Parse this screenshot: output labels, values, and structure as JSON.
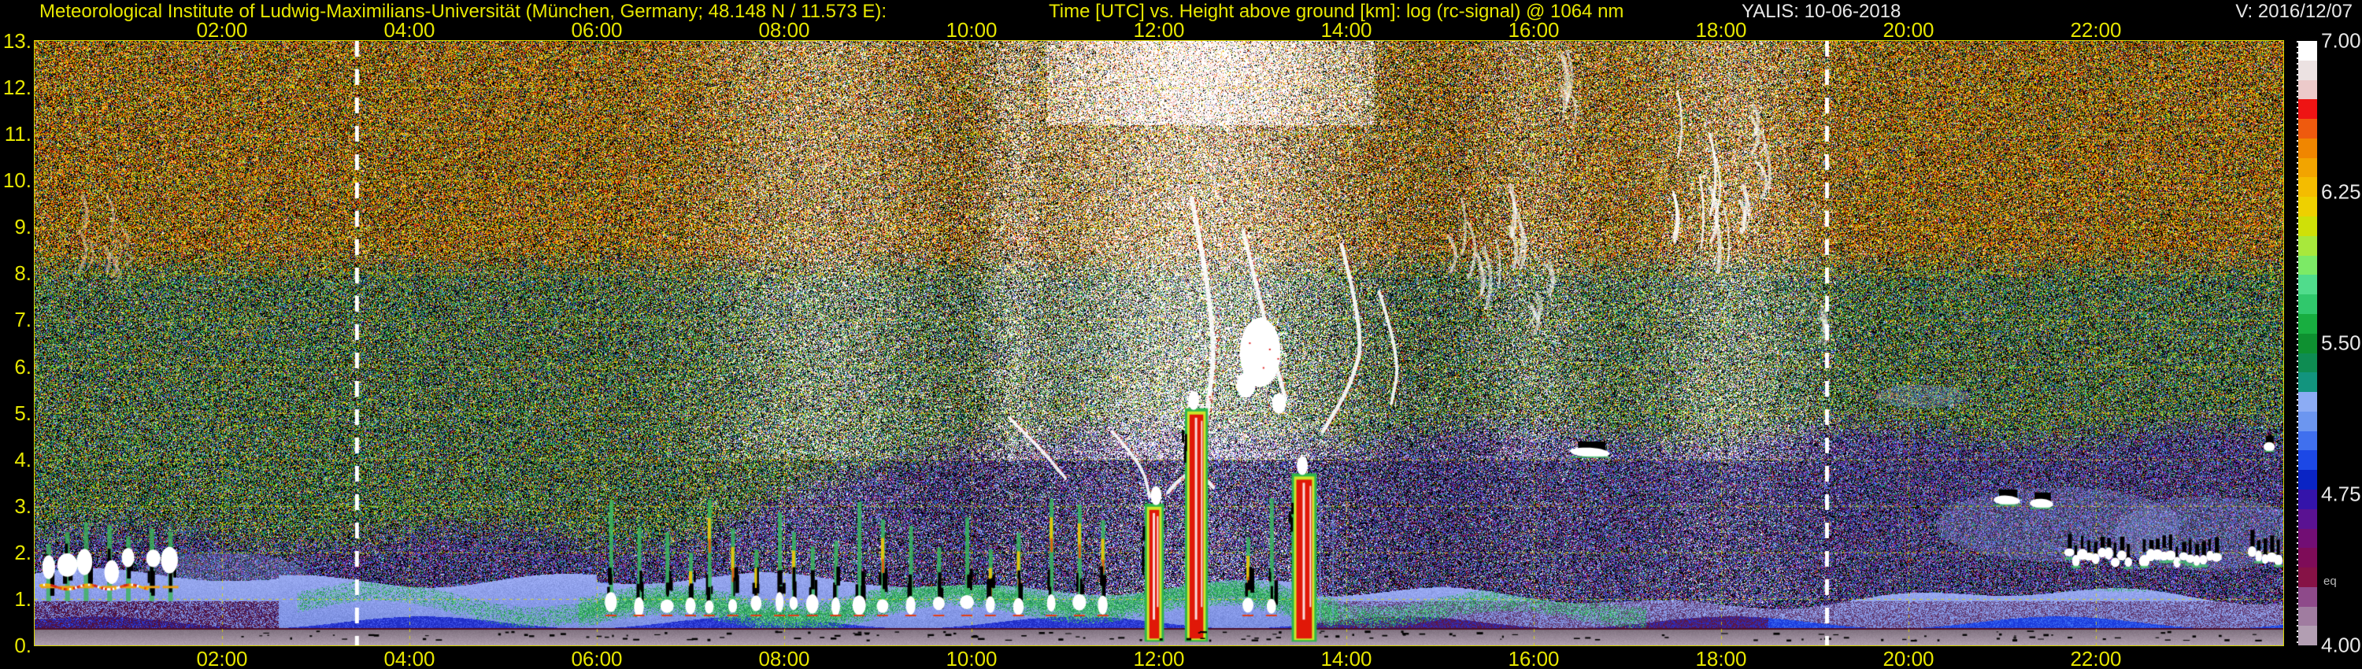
{
  "header": {
    "institute": "Meteorological Institute of Ludwig-Maximilians-Universität (München, Germany; 48.148 N / 11.573 E):",
    "plot_title": "Time [UTC] vs. Height above ground [km]: log (rc-signal) @ 1064 nm",
    "system_date": "YALIS: 10-06-2018",
    "version": "V: 2016/12/07"
  },
  "axes": {
    "x_ticks": {
      "hours": [
        2,
        4,
        6,
        8,
        10,
        12,
        14,
        16,
        18,
        20,
        22
      ],
      "labels": [
        "02:00",
        "04:00",
        "06:00",
        "08:00",
        "10:00",
        "12:00",
        "14:00",
        "16:00",
        "18:00",
        "20:00",
        "22:00"
      ]
    },
    "y_ticks": {
      "km": [
        13,
        12,
        11,
        10,
        9,
        8,
        7,
        6,
        5,
        4,
        3,
        2,
        1,
        0
      ],
      "labels": [
        "13.",
        "12.",
        "11.",
        "10.",
        "9.",
        "8.",
        "7.",
        "6.",
        "5.",
        "4.",
        "3.",
        "2.",
        "1.",
        "0."
      ]
    }
  },
  "colorbar": {
    "labels": [
      "7.00",
      "6.25",
      "5.50",
      "4.75",
      "4.00"
    ],
    "eq_label": "eq",
    "colors": [
      "#ffffff",
      "#ece2e2",
      "#eccaca",
      "#ee1414",
      "#ee5a0e",
      "#f08600",
      "#f2a400",
      "#f4bc00",
      "#eed000",
      "#cfe008",
      "#a8e83c",
      "#7cea66",
      "#50dc8c",
      "#30c86c",
      "#18ae40",
      "#0e9030",
      "#0e8c52",
      "#12947e",
      "#8cacf4",
      "#6c96f0",
      "#4070ee",
      "#1c48e6",
      "#0a24c4",
      "#3414aa",
      "#5a1292",
      "#720e74",
      "#7e0c58",
      "#861246",
      "#8e4a8a",
      "#a07ca0",
      "#b29eb2"
    ]
  },
  "colors": {
    "axis_text": "#e6e600",
    "plot_border": "#d8d800",
    "grid": "#d8d800",
    "sun_line": "#ffffff",
    "background": "#000000"
  },
  "chart_data": {
    "type": "heatmap",
    "title": "Time [UTC] vs. Height above ground [km]: log (rc-signal) @ 1064 nm",
    "xlabel": "Time [UTC]",
    "ylabel": "Height above ground [km]",
    "x_range_hours": [
      0,
      24
    ],
    "y_range_km": [
      0,
      13
    ],
    "value_label": "log (rc-signal) @ 1064 nm",
    "value_range": [
      4.0,
      7.0
    ],
    "colorbar_ticks": [
      7.0,
      6.25,
      5.5,
      4.75,
      4.0
    ],
    "grid": {
      "x_step_hours": 2,
      "y_step_km": 1,
      "style": "dotted-yellow"
    },
    "sun_marker_hours": [
      3.44,
      19.13
    ],
    "render": {
      "seed": 20180610,
      "speckle_colors": {
        "black": [
          0,
          0,
          0
        ],
        "red": [
          225,
          40,
          20
        ],
        "orange": [
          240,
          125,
          10
        ],
        "amber": [
          246,
          176,
          0
        ],
        "yellow": [
          238,
          222,
          0
        ],
        "lime": [
          168,
          224,
          40
        ],
        "green": [
          40,
          170,
          70
        ],
        "teal": [
          20,
          150,
          120
        ],
        "blue": [
          60,
          90,
          235
        ],
        "periwinkle": [
          140,
          160,
          240
        ],
        "indigo": [
          70,
          40,
          175
        ],
        "purple": [
          120,
          30,
          140
        ],
        "magenta": [
          150,
          25,
          100
        ],
        "white": [
          255,
          255,
          255
        ],
        "pink": [
          236,
          200,
          200
        ]
      },
      "speckle_palettes": {
        "hot": [
          [
            "black",
            0.34
          ],
          [
            "red",
            0.13
          ],
          [
            "orange",
            0.15
          ],
          [
            "amber",
            0.06
          ],
          [
            "yellow",
            0.12
          ],
          [
            "lime",
            0.04
          ],
          [
            "green",
            0.06
          ],
          [
            "teal",
            0.03
          ],
          [
            "blue",
            0.03
          ],
          [
            "periwinkle",
            0.01
          ],
          [
            "white",
            0.02
          ],
          [
            "pink",
            0.01
          ]
        ],
        "green": [
          [
            "black",
            0.37
          ],
          [
            "green",
            0.15
          ],
          [
            "teal",
            0.09
          ],
          [
            "lime",
            0.07
          ],
          [
            "yellow",
            0.07
          ],
          [
            "orange",
            0.05
          ],
          [
            "red",
            0.03
          ],
          [
            "blue",
            0.07
          ],
          [
            "periwinkle",
            0.04
          ],
          [
            "indigo",
            0.02
          ],
          [
            "purple",
            0.02
          ],
          [
            "white",
            0.02
          ]
        ],
        "cool": [
          [
            "black",
            0.33
          ],
          [
            "blue",
            0.14
          ],
          [
            "periwinkle",
            0.11
          ],
          [
            "purple",
            0.13
          ],
          [
            "indigo",
            0.08
          ],
          [
            "magenta",
            0.06
          ],
          [
            "teal",
            0.05
          ],
          [
            "green",
            0.05
          ],
          [
            "red",
            0.02
          ],
          [
            "orange",
            0.02
          ],
          [
            "white",
            0.01
          ]
        ]
      },
      "white_columns": [
        {
          "t": 8.4,
          "s": 0.8,
          "a": 0.3
        },
        {
          "t": 10.45,
          "s": 0.22,
          "a": 0.25
        },
        {
          "t": 12.4,
          "s": 1.15,
          "a": 0.55
        },
        {
          "t": 16.0,
          "s": 0.45,
          "a": 0.22
        },
        {
          "t": 18.1,
          "s": 0.6,
          "a": 0.3
        }
      ],
      "dark_columns": [
        {
          "t": 10.2,
          "s": 0.55,
          "a": 0.12
        },
        {
          "t": 14.8,
          "s": 0.9,
          "a": 0.08
        }
      ],
      "features": {
        "morning_cluster": {
          "t0": 0.05,
          "t1": 1.6,
          "blob_times": [
            0.15,
            0.35,
            0.55,
            0.8,
            1.0,
            1.25,
            1.45
          ],
          "top_km": 2.9,
          "rim_km": 1.28
        },
        "cumulus_times": [
          6.15,
          6.45,
          6.75,
          7.0,
          7.2,
          7.45,
          7.7,
          7.95,
          8.1,
          8.3,
          8.55,
          8.8,
          9.05,
          9.35,
          9.65,
          9.95,
          10.2,
          10.5,
          10.85,
          11.15,
          11.4,
          12.95,
          13.2
        ],
        "precip_columns": [
          {
            "t": 11.95,
            "half_w_h": 0.07,
            "top_km": 3.05
          },
          {
            "t": 12.4,
            "half_w_h": 0.09,
            "top_km": 5.1
          },
          {
            "t": 13.55,
            "half_w_h": 0.1,
            "top_km": 3.7
          }
        ],
        "virga_streaks": [
          {
            "pts": [
              [
                12.35,
                9.6
              ],
              [
                12.62,
                6.9
              ],
              [
                12.52,
                5.0
              ],
              [
                12.44,
                4.2
              ]
            ],
            "w": 6
          },
          {
            "pts": [
              [
                12.9,
                8.9
              ],
              [
                13.2,
                6.4
              ],
              [
                13.35,
                5.3
              ]
            ],
            "w": 5
          },
          {
            "pts": [
              [
                13.95,
                8.6
              ],
              [
                14.2,
                6.7
              ],
              [
                14.05,
                5.6
              ],
              [
                13.75,
                4.6
              ]
            ],
            "w": 5
          },
          {
            "pts": [
              [
                14.35,
                7.6
              ],
              [
                14.58,
                6.2
              ],
              [
                14.48,
                5.2
              ]
            ],
            "w": 4
          },
          {
            "pts": [
              [
                10.4,
                4.9
              ],
              [
                10.75,
                4.2
              ],
              [
                11.0,
                3.6
              ]
            ],
            "w": 4
          },
          {
            "pts": [
              [
                11.5,
                4.6
              ],
              [
                11.82,
                3.9
              ],
              [
                11.9,
                3.2
              ]
            ],
            "w": 4
          },
          {
            "pts": [
              [
                12.1,
                3.3
              ],
              [
                12.35,
                3.9
              ],
              [
                12.58,
                3.4
              ]
            ],
            "w": 5
          }
        ],
        "white_blobs": [
          {
            "t": 13.08,
            "km": 6.3,
            "rw": 26,
            "rh": 44
          },
          {
            "t": 12.93,
            "km": 5.6,
            "rw": 12,
            "rh": 16
          },
          {
            "t": 13.28,
            "km": 5.2,
            "rw": 9,
            "rh": 13
          }
        ],
        "cirrus_patches": [
          {
            "t": 0.55,
            "km": 8.9,
            "w": 0.45,
            "h": 1.3,
            "alpha": 0.45,
            "warm": true
          },
          {
            "t": 0.9,
            "km": 8.4,
            "w": 0.3,
            "h": 0.8,
            "alpha": 0.4,
            "warm": true
          },
          {
            "t": 15.25,
            "km": 8.2,
            "w": 0.45,
            "h": 2.0,
            "alpha": 0.55,
            "warm": false
          },
          {
            "t": 15.75,
            "km": 8.8,
            "w": 0.35,
            "h": 1.9,
            "alpha": 0.6,
            "warm": false
          },
          {
            "t": 16.05,
            "km": 7.4,
            "w": 0.3,
            "h": 1.2,
            "alpha": 0.5,
            "warm": false
          },
          {
            "t": 16.36,
            "km": 11.9,
            "w": 0.2,
            "h": 1.6,
            "alpha": 0.5,
            "warm": false
          },
          {
            "t": 17.7,
            "km": 10.0,
            "w": 0.45,
            "h": 2.7,
            "alpha": 0.85,
            "warm": false
          },
          {
            "t": 18.05,
            "km": 8.9,
            "w": 0.4,
            "h": 2.1,
            "alpha": 0.7,
            "warm": false
          },
          {
            "t": 18.4,
            "km": 10.6,
            "w": 0.25,
            "h": 1.4,
            "alpha": 0.6,
            "warm": false
          },
          {
            "t": 19.0,
            "km": 7.1,
            "w": 0.2,
            "h": 0.8,
            "alpha": 0.4,
            "warm": false
          }
        ],
        "mid_cloud_dashes": [
          {
            "t": 16.6,
            "km": 4.15,
            "w": 0.42
          },
          {
            "t": 21.05,
            "km": 3.12,
            "w": 0.28
          },
          {
            "t": 21.42,
            "km": 3.05,
            "w": 0.25
          },
          {
            "t": 23.85,
            "km": 4.27,
            "w": 0.12
          }
        ],
        "evening_cloud_rows": [
          {
            "t0": 21.7,
            "t1": 22.35,
            "km": 1.75
          },
          {
            "t0": 22.5,
            "t1": 23.3,
            "km": 1.7
          },
          {
            "t0": 23.65,
            "t1": 23.98,
            "km": 1.8
          }
        ],
        "haze_patches": [
          {
            "t": 21.6,
            "km": 2.6,
            "rw": 1.3,
            "rh": 0.8
          },
          {
            "t": 23.2,
            "km": 2.4,
            "rw": 1.0,
            "rh": 0.8
          },
          {
            "t": 20.15,
            "km": 5.35,
            "rw": 0.5,
            "rh": 0.25
          },
          {
            "t": 2.0,
            "km": 1.5,
            "rw": 0.9,
            "rh": 0.5
          }
        ],
        "faint_streaks": [
          {
            "t": 13.72,
            "km0": 3.2,
            "km1": 0.6
          },
          {
            "t": 13.86,
            "km0": 2.8,
            "km1": 0.6
          }
        ]
      }
    }
  }
}
